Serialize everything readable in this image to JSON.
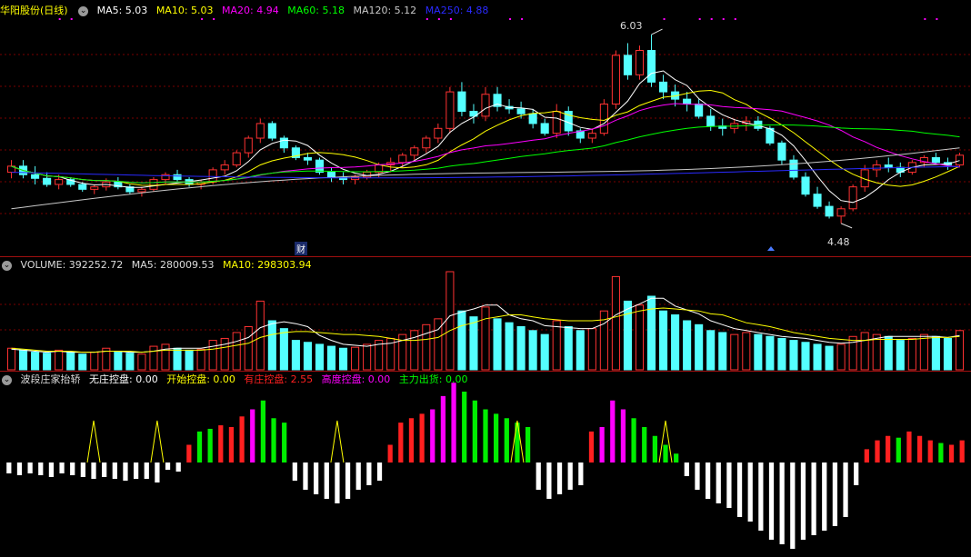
{
  "stock": {
    "name": "华阳股份",
    "period": "(日线)"
  },
  "ma_legend": [
    {
      "label": "MA5: 5.03",
      "color": "#ffffff"
    },
    {
      "label": "MA10: 5.03",
      "color": "#ffff00"
    },
    {
      "label": "MA20: 4.94",
      "color": "#ff00ff"
    },
    {
      "label": "MA60: 5.18",
      "color": "#00ff00"
    },
    {
      "label": "MA120: 5.12",
      "color": "#c8c8c8"
    },
    {
      "label": "MA250: 4.88",
      "color": "#2a2aff"
    }
  ],
  "vol_legend": [
    {
      "label": "VOLUME: 392252.72",
      "color": "#dcdcdc"
    },
    {
      "label": "MA5: 280009.53",
      "color": "#dcdcdc"
    },
    {
      "label": "MA10: 298303.94",
      "color": "#ffff00"
    }
  ],
  "ind_legend": [
    {
      "label": "波段庄家抬轿",
      "color": "#dcdcdc"
    },
    {
      "label": "无庄控盘: 0.00",
      "color": "#ffffff"
    },
    {
      "label": "开始控盘: 0.00",
      "color": "#ffff00"
    },
    {
      "label": "有庄控盘: 2.55",
      "color": "#ff2020"
    },
    {
      "label": "高度控盘: 0.00",
      "color": "#ff00ff"
    },
    {
      "label": "主力出货: 0.00",
      "color": "#00ff00"
    }
  ],
  "annotations": {
    "high": "6.03",
    "low": "4.48",
    "marker": "财"
  },
  "colors": {
    "up": "#ff3232",
    "down": "#54ffff",
    "grid": "#7a0000"
  },
  "chart_data": [
    {
      "type": "candlestick",
      "title": "华阳股份 (日线)",
      "price_range": [
        4.3,
        6.15
      ],
      "ohlc": [
        [
          4.9,
          5.0,
          4.85,
          4.95
        ],
        [
          4.95,
          5.0,
          4.85,
          4.88
        ],
        [
          4.88,
          4.95,
          4.8,
          4.85
        ],
        [
          4.85,
          4.9,
          4.78,
          4.8
        ],
        [
          4.8,
          4.88,
          4.76,
          4.84
        ],
        [
          4.84,
          4.86,
          4.78,
          4.8
        ],
        [
          4.8,
          4.82,
          4.74,
          4.76
        ],
        [
          4.76,
          4.8,
          4.72,
          4.78
        ],
        [
          4.78,
          4.85,
          4.75,
          4.82
        ],
        [
          4.82,
          4.86,
          4.76,
          4.78
        ],
        [
          4.78,
          4.8,
          4.72,
          4.74
        ],
        [
          4.74,
          4.78,
          4.7,
          4.76
        ],
        [
          4.76,
          4.86,
          4.74,
          4.84
        ],
        [
          4.84,
          4.9,
          4.8,
          4.88
        ],
        [
          4.88,
          4.92,
          4.82,
          4.84
        ],
        [
          4.84,
          4.86,
          4.78,
          4.8
        ],
        [
          4.8,
          4.84,
          4.76,
          4.82
        ],
        [
          4.82,
          4.94,
          4.8,
          4.92
        ],
        [
          4.92,
          5.0,
          4.88,
          4.96
        ],
        [
          4.96,
          5.08,
          4.94,
          5.06
        ],
        [
          5.06,
          5.2,
          5.02,
          5.18
        ],
        [
          5.18,
          5.34,
          5.14,
          5.3
        ],
        [
          5.3,
          5.32,
          5.16,
          5.18
        ],
        [
          5.18,
          5.2,
          5.06,
          5.1
        ],
        [
          5.1,
          5.12,
          5.0,
          5.02
        ],
        [
          5.02,
          5.06,
          4.96,
          5.0
        ],
        [
          5.0,
          5.02,
          4.88,
          4.9
        ],
        [
          4.9,
          4.94,
          4.82,
          4.86
        ],
        [
          4.86,
          4.9,
          4.8,
          4.84
        ],
        [
          4.84,
          4.88,
          4.8,
          4.86
        ],
        [
          4.86,
          4.92,
          4.84,
          4.9
        ],
        [
          4.9,
          4.98,
          4.86,
          4.96
        ],
        [
          4.96,
          5.02,
          4.9,
          4.98
        ],
        [
          4.98,
          5.06,
          4.94,
          5.04
        ],
        [
          5.04,
          5.12,
          5.0,
          5.1
        ],
        [
          5.1,
          5.2,
          5.06,
          5.18
        ],
        [
          5.18,
          5.3,
          5.14,
          5.26
        ],
        [
          5.26,
          5.6,
          5.22,
          5.56
        ],
        [
          5.56,
          5.64,
          5.36,
          5.4
        ],
        [
          5.4,
          5.46,
          5.3,
          5.36
        ],
        [
          5.36,
          5.6,
          5.32,
          5.54
        ],
        [
          5.54,
          5.6,
          5.4,
          5.44
        ],
        [
          5.44,
          5.5,
          5.38,
          5.42
        ],
        [
          5.42,
          5.48,
          5.34,
          5.38
        ],
        [
          5.38,
          5.42,
          5.26,
          5.3
        ],
        [
          5.3,
          5.34,
          5.2,
          5.22
        ],
        [
          5.22,
          5.46,
          5.18,
          5.4
        ],
        [
          5.4,
          5.44,
          5.2,
          5.24
        ],
        [
          5.24,
          5.26,
          5.14,
          5.18
        ],
        [
          5.18,
          5.26,
          5.14,
          5.22
        ],
        [
          5.22,
          5.5,
          5.2,
          5.46
        ],
        [
          5.46,
          5.9,
          5.42,
          5.86
        ],
        [
          5.86,
          5.96,
          5.66,
          5.7
        ],
        [
          5.7,
          5.94,
          5.66,
          5.9
        ],
        [
          5.9,
          6.03,
          5.6,
          5.64
        ],
        [
          5.64,
          5.7,
          5.5,
          5.56
        ],
        [
          5.56,
          5.62,
          5.44,
          5.5
        ],
        [
          5.5,
          5.56,
          5.4,
          5.46
        ],
        [
          5.46,
          5.5,
          5.34,
          5.36
        ],
        [
          5.36,
          5.42,
          5.24,
          5.28
        ],
        [
          5.28,
          5.34,
          5.2,
          5.26
        ],
        [
          5.26,
          5.34,
          5.22,
          5.3
        ],
        [
          5.3,
          5.36,
          5.24,
          5.32
        ],
        [
          5.32,
          5.36,
          5.24,
          5.26
        ],
        [
          5.26,
          5.28,
          5.12,
          5.14
        ],
        [
          5.14,
          5.16,
          4.96,
          5.0
        ],
        [
          5.0,
          5.04,
          4.84,
          4.86
        ],
        [
          4.86,
          4.9,
          4.7,
          4.72
        ],
        [
          4.72,
          4.78,
          4.6,
          4.62
        ],
        [
          4.62,
          4.66,
          4.52,
          4.54
        ],
        [
          4.54,
          4.62,
          4.48,
          4.6
        ],
        [
          4.6,
          4.8,
          4.58,
          4.78
        ],
        [
          4.78,
          4.96,
          4.74,
          4.92
        ],
        [
          4.92,
          5.0,
          4.86,
          4.96
        ],
        [
          4.96,
          5.02,
          4.9,
          4.94
        ],
        [
          4.94,
          4.98,
          4.86,
          4.9
        ],
        [
          4.9,
          5.0,
          4.88,
          4.98
        ],
        [
          4.98,
          5.04,
          4.94,
          5.02
        ],
        [
          5.02,
          5.06,
          4.96,
          4.98
        ],
        [
          4.98,
          5.02,
          4.92,
          4.96
        ],
        [
          4.96,
          5.06,
          4.94,
          5.04
        ]
      ],
      "ma": {
        "MA5": 5.03,
        "MA10": 5.03,
        "MA20": 4.94,
        "MA60": 5.18,
        "MA120": 5.12,
        "MA250": 4.88
      },
      "high_mark": 6.03,
      "low_mark": 4.48
    },
    {
      "type": "bar",
      "title": "VOLUME",
      "ylim": [
        0,
        100
      ],
      "values": [
        22,
        20,
        18,
        17,
        20,
        18,
        16,
        18,
        22,
        19,
        17,
        16,
        24,
        26,
        22,
        20,
        21,
        30,
        32,
        38,
        44,
        70,
        50,
        42,
        30,
        28,
        26,
        24,
        22,
        23,
        26,
        30,
        32,
        36,
        40,
        46,
        52,
        100,
        60,
        54,
        64,
        52,
        48,
        44,
        40,
        36,
        50,
        44,
        40,
        42,
        60,
        95,
        70,
        66,
        75,
        60,
        56,
        50,
        46,
        40,
        38,
        36,
        38,
        36,
        34,
        32,
        30,
        28,
        26,
        24,
        26,
        34,
        38,
        36,
        34,
        30,
        32,
        36,
        34,
        32,
        40
      ],
      "ma5": [
        21,
        20,
        19,
        18,
        19,
        18,
        18,
        18,
        19,
        19,
        18,
        18,
        19,
        21,
        22,
        22,
        22,
        24,
        26,
        29,
        33,
        43,
        47,
        49,
        47,
        44,
        35,
        30,
        26,
        25,
        24,
        26,
        27,
        30,
        33,
        37,
        41,
        55,
        59,
        62,
        66,
        66,
        56,
        52,
        50,
        45,
        44,
        43,
        42,
        42,
        47,
        56,
        62,
        67,
        73,
        73,
        65,
        61,
        57,
        50,
        46,
        42,
        40,
        38,
        36,
        34,
        33,
        32,
        30,
        28,
        27,
        28,
        30,
        32,
        34,
        34,
        34,
        34,
        34,
        33,
        35
      ],
      "ma10": [
        22,
        21,
        20,
        19,
        19,
        19,
        18,
        18,
        19,
        19,
        19,
        18,
        19,
        20,
        20,
        20,
        20,
        21,
        23,
        25,
        27,
        33,
        36,
        38,
        39,
        39,
        38,
        37,
        36,
        36,
        35,
        34,
        32,
        30,
        30,
        31,
        33,
        40,
        45,
        48,
        52,
        54,
        56,
        56,
        54,
        52,
        51,
        50,
        50,
        50,
        51,
        54,
        57,
        60,
        62,
        63,
        62,
        61,
        60,
        57,
        56,
        52,
        48,
        46,
        44,
        41,
        38,
        36,
        34,
        32,
        31,
        30,
        30,
        31,
        31,
        31,
        31,
        32,
        33,
        33,
        34
      ]
    },
    {
      "type": "bar",
      "title": "波段庄家抬轿",
      "ylim": [
        -100,
        80
      ],
      "values": [
        -12,
        -14,
        -12,
        -14,
        -16,
        -12,
        -14,
        -16,
        -18,
        -16,
        -18,
        -20,
        -18,
        -18,
        -22,
        -8,
        -10,
        20,
        35,
        38,
        42,
        40,
        52,
        60,
        70,
        50,
        45,
        -20,
        -30,
        -35,
        -40,
        -45,
        -40,
        -30,
        -25,
        -20,
        20,
        45,
        50,
        55,
        60,
        75,
        90,
        80,
        70,
        60,
        55,
        50,
        45,
        40,
        -30,
        -40,
        -35,
        -30,
        -25,
        35,
        40,
        70,
        60,
        50,
        40,
        30,
        20,
        10,
        -15,
        -30,
        -40,
        -45,
        -50,
        -60,
        -65,
        -75,
        -85,
        -90,
        -95,
        -85,
        -80,
        -75,
        -70,
        -60,
        -25,
        15,
        25,
        30,
        28,
        35,
        30,
        25,
        22,
        20,
        25
      ],
      "kinds": [
        "w",
        "w",
        "w",
        "w",
        "w",
        "w",
        "w",
        "w",
        "w",
        "w",
        "w",
        "w",
        "w",
        "w",
        "w",
        "w",
        "w",
        "r",
        "g",
        "g",
        "r",
        "r",
        "r",
        "m",
        "g",
        "g",
        "g",
        "w",
        "w",
        "w",
        "w",
        "w",
        "w",
        "w",
        "w",
        "w",
        "r",
        "r",
        "r",
        "r",
        "m",
        "m",
        "m",
        "g",
        "g",
        "g",
        "g",
        "g",
        "g",
        "g",
        "w",
        "w",
        "w",
        "w",
        "w",
        "r",
        "m",
        "m",
        "m",
        "g",
        "g",
        "g",
        "g",
        "g",
        "w",
        "w",
        "w",
        "w",
        "w",
        "w",
        "w",
        "w",
        "w",
        "w",
        "w",
        "w",
        "w",
        "w",
        "w",
        "w",
        "w",
        "r",
        "r",
        "r",
        "g",
        "r",
        "r",
        "r",
        "g",
        "r",
        "r"
      ],
      "signal_points": [
        8,
        14,
        31,
        48,
        62
      ]
    }
  ]
}
